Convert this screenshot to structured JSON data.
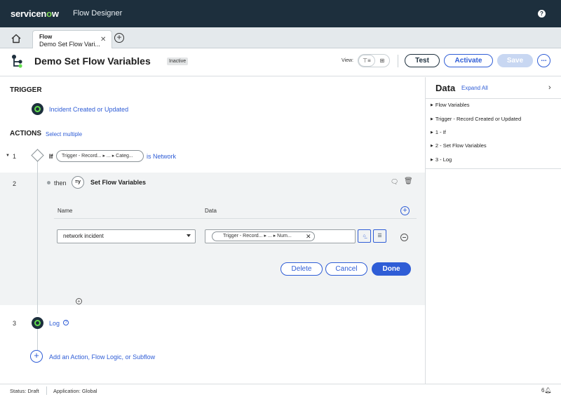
{
  "header": {
    "brand_prefix": "servicen",
    "brand_o": "o",
    "brand_suffix": "w",
    "product": "Flow Designer",
    "help_glyph": "?"
  },
  "tabs": {
    "home_icon": "home-icon",
    "active": {
      "kind": "Flow",
      "title": "Demo Set Flow Vari...",
      "close_glyph": "✕"
    },
    "add_glyph": "+"
  },
  "flow": {
    "name": "Demo Set Flow Variables",
    "state": "Inactive",
    "view_label": "View:",
    "view_options": [
      "list-view-icon",
      "grid-view-icon"
    ],
    "buttons": {
      "test": "Test",
      "activate": "Activate",
      "save": "Save",
      "more": "..."
    }
  },
  "canvas": {
    "trigger_heading": "TRIGGER",
    "trigger_label": "Incident Created or Updated",
    "actions_heading": "ACTIONS",
    "select_multiple": "Select multiple",
    "steps": [
      {
        "number": "1",
        "caret": "▼",
        "keyword": "If",
        "pill": "Trigger - Record... ▸ ... ▸ Categ...",
        "condition": "is Network"
      },
      {
        "number": "2",
        "keyword": "then",
        "icon_text": "=y",
        "action": "Set Flow Variables"
      },
      {
        "number": "3",
        "label": "Log",
        "help": "?"
      }
    ],
    "variables_panel": {
      "col_name": "Name",
      "col_data": "Data",
      "add_glyph": "+",
      "row": {
        "name_value": "network incident",
        "data_pill": "Trigger - Record... ▸ ... ▸ Num...",
        "data_pill_x": "✕"
      },
      "buttons": {
        "delete": "Delete",
        "cancel": "Cancel",
        "done": "Done"
      }
    },
    "add_small": "+",
    "add_action_glyph": "+",
    "add_action_label": "Add an Action, Flow Logic, or Subflow"
  },
  "data_panel": {
    "heading": "Data",
    "expand_all": "Expand All",
    "close_glyph": "›",
    "items": [
      "Flow Variables",
      "Trigger - Record Created or Updated",
      "1 - If",
      "2 - Set Flow Variables",
      "3 - Log"
    ]
  },
  "status": {
    "status_text": "Status: Draft",
    "application_text": "Application: Global",
    "notifications": "6"
  }
}
